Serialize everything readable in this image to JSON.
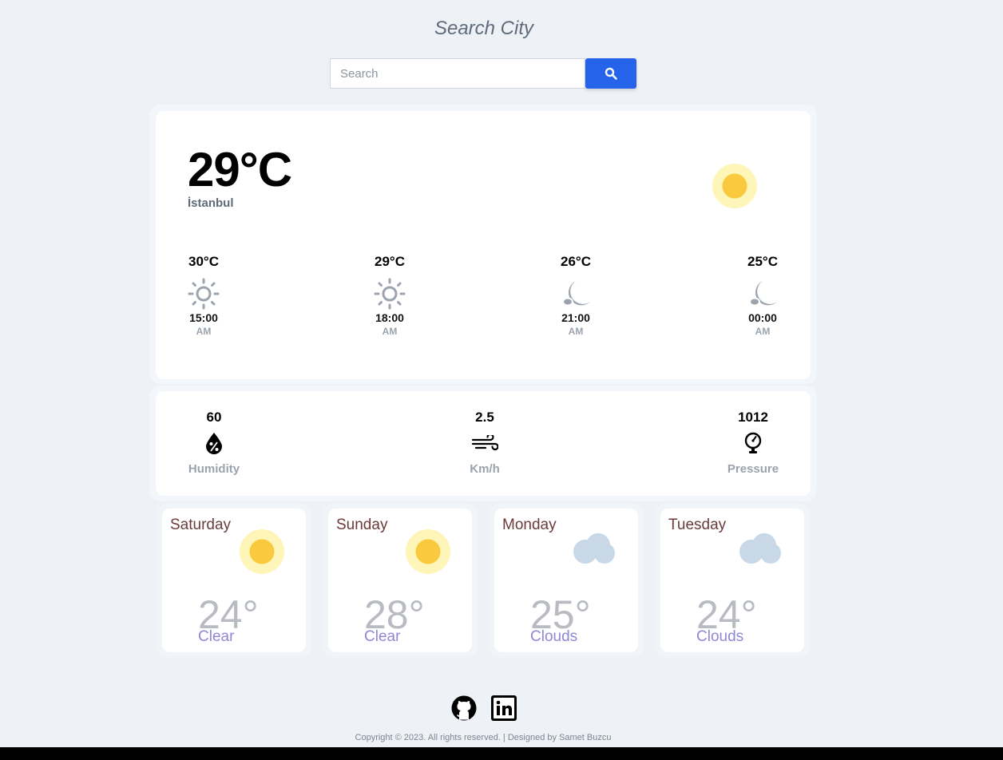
{
  "header": {
    "title": "Search City"
  },
  "search": {
    "placeholder": "Search",
    "button_icon": "search-icon"
  },
  "current": {
    "temperature": "29°C",
    "city": "İstanbul",
    "icon": "sun-icon"
  },
  "hourly": [
    {
      "temp": "30°C",
      "icon": "sun-outline-icon",
      "time": "15:00",
      "period": "AM"
    },
    {
      "temp": "29°C",
      "icon": "sun-outline-icon",
      "time": "18:00",
      "period": "AM"
    },
    {
      "temp": "26°C",
      "icon": "moon-cloud-icon",
      "time": "21:00",
      "period": "AM"
    },
    {
      "temp": "25°C",
      "icon": "moon-cloud-icon",
      "time": "00:00",
      "period": "AM"
    }
  ],
  "stats": {
    "humidity": {
      "value": "60",
      "label": "Humidity",
      "icon": "humidity-drop-icon"
    },
    "wind": {
      "value": "2.5",
      "label": "Km/h",
      "icon": "wind-icon"
    },
    "pressure": {
      "value": "1012",
      "label": "Pressure",
      "icon": "pressure-gauge-icon"
    }
  },
  "daily": [
    {
      "day": "Saturday",
      "temp": "24°",
      "desc": "Clear",
      "icon": "sun-icon"
    },
    {
      "day": "Sunday",
      "temp": "28°",
      "desc": "Clear",
      "icon": "sun-icon"
    },
    {
      "day": "Monday",
      "temp": "25°",
      "desc": "Clouds",
      "icon": "cloud-icon"
    },
    {
      "day": "Tuesday",
      "temp": "24°",
      "desc": "Clouds",
      "icon": "cloud-icon"
    }
  ],
  "footer": {
    "links": [
      "github-icon",
      "linkedin-icon"
    ],
    "copyright": "Copyright © 2023. All rights reserved. | Designed by Samet Buzcu"
  },
  "colors": {
    "accent": "#2563eb",
    "background": "#eef2f7",
    "sun": "#fbc93d",
    "sun_glow": "#fdf6b8",
    "cloud": "#c9d8e6"
  }
}
